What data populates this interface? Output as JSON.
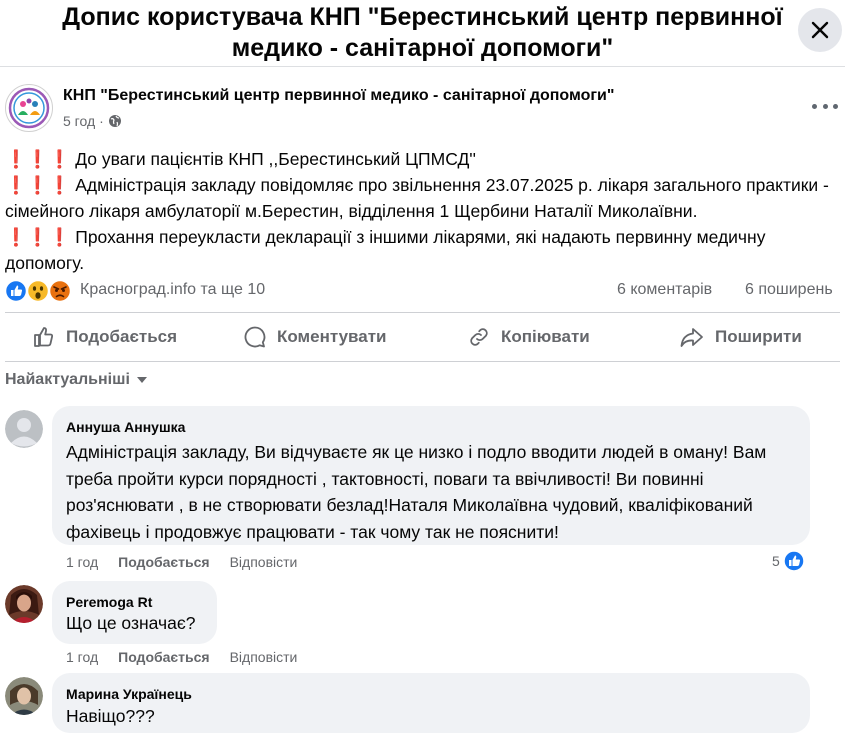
{
  "dialog": {
    "title_line1": "Допис користувача КНП \"Берестинський центр первинної",
    "title_line2": "медико - санітарної допомоги\""
  },
  "post": {
    "page_name": "КНП \"Берестинський центр первинної медико - санітарної допомоги\"",
    "time": "5 год",
    "separator": "·",
    "lines": [
      {
        "prefix": "❗❗❗",
        "text": "До уваги пацієнтів КНП ,,Берестинський ЦПМСД''"
      },
      {
        "prefix": "❗❗❗",
        "text": "Адміністрація закладу повідомляє про звільнення 23.07.2025 р. лікаря загального практики - сімейного лікаря амбулаторії м.Берестин, відділення 1 Щербини Наталії Миколаївни."
      },
      {
        "prefix": "❗❗❗",
        "text": "Прохання переукласти декларації з іншими лікарями, які надають первинну медичну допомогу."
      }
    ],
    "reactions_by": "Красноград.info та ще 10",
    "comments_count": "6 коментарів",
    "shares_count": "6 поширень"
  },
  "actions": {
    "like": "Подобається",
    "comment": "Коментувати",
    "copy": "Копіювати",
    "share": "Поширити"
  },
  "sort_label": "Найактуальніші",
  "comments": [
    {
      "author": "Аннуша Аннушка",
      "text": "Адміністрація закладу, Ви відчуваєте як це низко і подло вводити людей в оману! Вам треба пройти курси порядності , тактовності, поваги та ввічливості! Ви повинні роз'яснювати , в не створювати безлад!Наталя Миколаївна чудовий, кваліфікований фахівець і продовжує працювати - так чому так не пояснити!",
      "time": "1 год",
      "like": "Подобається",
      "reply": "Відповісти",
      "likes": "5"
    },
    {
      "author": "Peremoga Rt",
      "text": "Що це означає?",
      "time": "1 год",
      "like": "Подобається",
      "reply": "Відповісти"
    },
    {
      "author": "Марина Українець",
      "text": "Навіщо???"
    }
  ],
  "icons": {
    "close": "close-icon",
    "privacy": "globe-icon",
    "more": "more-options-icon",
    "like": "like-icon",
    "comment": "comment-icon",
    "copy": "link-icon",
    "share": "share-icon",
    "sort": "caret-down-icon"
  },
  "colors": {
    "exclamation": "#dd2e44",
    "like_blue": "#1877f2",
    "angry": "#e9710f",
    "wow": "#f7b928",
    "bubble": "#f0f2f5",
    "secondary_text": "#65676b"
  }
}
